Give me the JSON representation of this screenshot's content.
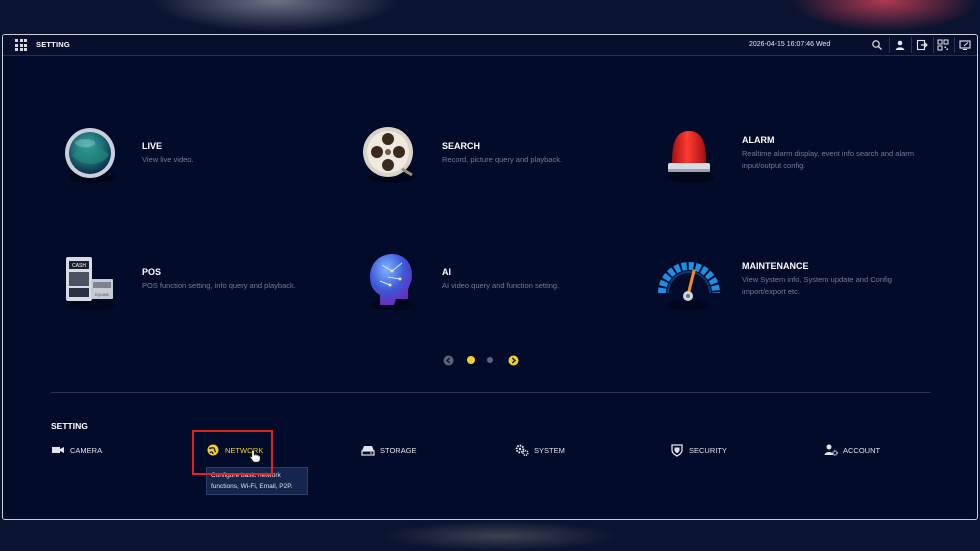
{
  "topbar": {
    "title": "SETTING",
    "datetime": "2026-04-15 16:07:46 Wed",
    "icons": [
      "search-icon",
      "user-icon",
      "logout-icon",
      "qr-code-icon",
      "fullscreen-icon"
    ]
  },
  "cards": [
    {
      "id": "live",
      "title": "LIVE",
      "desc": "View live video.",
      "icon": "live-globe-icon"
    },
    {
      "id": "search",
      "title": "SEARCH",
      "desc": "Record, picture query and playback.",
      "icon": "film-reel-icon"
    },
    {
      "id": "alarm",
      "title": "ALARM",
      "desc": "Realtime alarm display, event info search and alarm input/output config.",
      "icon": "alarm-light-icon"
    },
    {
      "id": "pos",
      "title": "POS",
      "desc": "POS function setting, info query and playback.",
      "icon": "pos-terminal-icon"
    },
    {
      "id": "ai",
      "title": "AI",
      "desc": "AI video query and function setting.",
      "icon": "ai-head-icon"
    },
    {
      "id": "maintenance",
      "title": "MAINTENANCE",
      "desc": "View System info, System update and Config import/export etc.",
      "icon": "gauge-icon"
    }
  ],
  "pager": {
    "current_page": 1,
    "total_pages": 2
  },
  "pos_art_text": {
    "top": "CASH",
    "bottom": "EQUIME"
  },
  "setting": {
    "label": "SETTING",
    "items": [
      {
        "label": "CAMERA",
        "icon": "camera-icon"
      },
      {
        "label": "NETWORK",
        "icon": "network-globe-icon",
        "active": true
      },
      {
        "label": "STORAGE",
        "icon": "storage-icon"
      },
      {
        "label": "SYSTEM",
        "icon": "gears-icon"
      },
      {
        "label": "SECURITY",
        "icon": "shield-icon"
      },
      {
        "label": "ACCOUNT",
        "icon": "account-gear-icon"
      }
    ],
    "tooltip": "Configure basic network functions, Wi-Fi, Email, P2P."
  },
  "colors": {
    "accent": "#f4cf2b",
    "background": "#020b2a",
    "highlight_box": "#e3231b"
  }
}
